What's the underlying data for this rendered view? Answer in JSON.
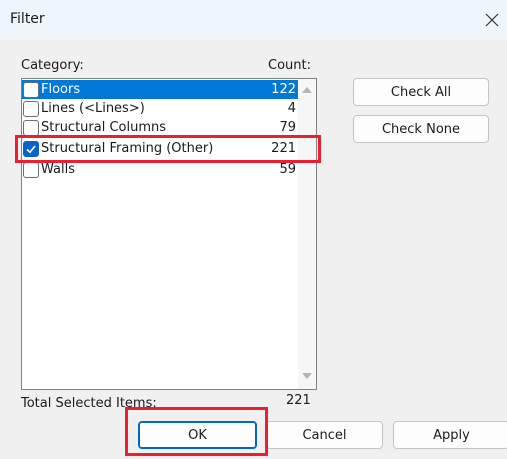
{
  "window": {
    "title": "Filter"
  },
  "category_header": "Category:",
  "count_header": "Count:",
  "categories": [
    {
      "name": "Floors",
      "count": "122",
      "checked": false,
      "highlighted": true
    },
    {
      "name": "Lines (<Lines>)",
      "count": "4",
      "checked": false,
      "highlighted": false
    },
    {
      "name": "Structural Columns",
      "count": "79",
      "checked": false,
      "highlighted": false
    },
    {
      "name": "Structural Framing (Other)",
      "count": "221",
      "checked": true,
      "highlighted": false
    },
    {
      "name": "Walls",
      "count": "59",
      "checked": false,
      "highlighted": false
    }
  ],
  "buttons": {
    "check_all": "Check All",
    "check_none": "Check None",
    "ok": "OK",
    "cancel": "Cancel",
    "apply": "Apply"
  },
  "total": {
    "label": "Total Selected Items:",
    "value": "221"
  },
  "colors": {
    "selection": "#0078d7",
    "annotation_red": "#e8202f",
    "ok_border": "#0067c0"
  }
}
